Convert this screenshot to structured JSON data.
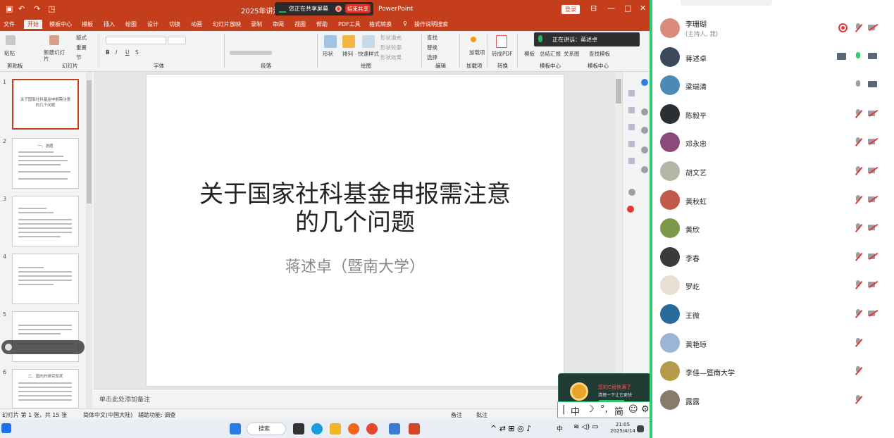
{
  "ppt": {
    "title_doc": "2025年讲演",
    "share_text": "您正在共享屏幕",
    "stop_share": "结束共享",
    "app_name": "PowerPoint",
    "login": "登录",
    "menu": [
      "文件",
      "开始",
      "模板中心",
      "模板",
      "插入",
      "绘图",
      "设计",
      "切换",
      "动画",
      "幻灯片放映",
      "录制",
      "审阅",
      "视图",
      "帮助",
      "PDF工具",
      "格式转换",
      "操作说明搜索"
    ],
    "active_menu": "开始",
    "ribbon_groups": [
      "剪贴板",
      "幻灯片",
      "字体",
      "段落",
      "绘图",
      "编辑",
      "加载项",
      "转换",
      "模板中心",
      "模板中心"
    ],
    "ribbon_labels": {
      "paste": "粘贴",
      "new_slide": "新建幻灯片",
      "layout": "版式",
      "reset": "重置",
      "section": "节",
      "shape": "形状",
      "arrange": "排列",
      "quick_style": "快速样式",
      "shape_fill": "形状填充",
      "shape_outline": "形状轮廓",
      "shape_effect": "形状效果",
      "find": "查找",
      "replace": "替换",
      "select": "选择",
      "addins": "加载项",
      "to_pdf": "转成PDF",
      "template": "模板",
      "summary": "总结汇报",
      "relation": "关系图",
      "find_template": "查找模板"
    },
    "speaking": "正在讲话：蒋述卓",
    "slide": {
      "title_line1": "关于国家社科基金申报需注意",
      "title_line2": "的几个问题",
      "subtitle": "蒋述卓（暨南大学）"
    },
    "thumb_numbers": [
      "1",
      "2",
      "3",
      "4",
      "5",
      "6"
    ],
    "thumb1_title": "关于国家社科基金申报需注意的几个问题",
    "thumb2_title": "一、选题",
    "thumb6_title": "二、国内外研究现状",
    "notes_placeholder": "单击此处添加备注",
    "status": {
      "slide_pos": "幻灯片 第 1 张，共 15 张",
      "lang": "简体中文(中国大陆)",
      "accessibility": "辅助功能: 调查",
      "notes": "备注",
      "comments": "批注"
    },
    "side_labels": [
      "打开",
      "设计",
      "帮助",
      "讲课"
    ]
  },
  "taskbar": {
    "search": "搜索",
    "time": "21:05",
    "date": "2025/4/14",
    "ime_label": "中"
  },
  "popup": {
    "line1": "您的C盘快满了",
    "line2": "清理一下让它更快"
  },
  "ime": {
    "chars": [
      "中",
      "简"
    ]
  },
  "participants": [
    {
      "name": "李珊瑚",
      "sub": "(主持人, 我)",
      "mic": "off",
      "cam": "off",
      "rec": true,
      "avatar_color": "#d98a7a"
    },
    {
      "name": "蒋述卓",
      "sub": "",
      "mic": "on",
      "cam": "on",
      "screen": true,
      "avatar_color": "#3a4a5a"
    },
    {
      "name": "梁瑞清",
      "sub": "",
      "mic": "plain",
      "cam": "on",
      "avatar_color": "#4a8ab5"
    },
    {
      "name": "陈毅平",
      "sub": "",
      "mic": "off",
      "cam": "off",
      "avatar_color": "#2b2f33"
    },
    {
      "name": "邓永忠",
      "sub": "",
      "mic": "off",
      "cam": "off",
      "avatar_color": "#8a4a7a"
    },
    {
      "name": "胡文艺",
      "sub": "",
      "mic": "off",
      "cam": "off",
      "avatar_color": "#b5b5a5"
    },
    {
      "name": "黄秋虹",
      "sub": "",
      "mic": "off",
      "cam": "off",
      "avatar_color": "#c05a4a"
    },
    {
      "name": "黄欣",
      "sub": "",
      "mic": "off",
      "cam": "off",
      "avatar_color": "#7a9a4a"
    },
    {
      "name": "李春",
      "sub": "",
      "mic": "off",
      "cam": "off",
      "avatar_color": "#3a3a3a"
    },
    {
      "name": "罗屹",
      "sub": "",
      "mic": "off",
      "cam": "off",
      "avatar_color": "#e8e0d0"
    },
    {
      "name": "王微",
      "sub": "",
      "mic": "off",
      "cam": "off",
      "avatar_color": "#2a6a9a"
    },
    {
      "name": "黄艳琼",
      "sub": "",
      "mic": "off",
      "cam": "none",
      "avatar_color": "#9ab5d5"
    },
    {
      "name": "李佳—暨南大学",
      "sub": "",
      "mic": "off",
      "cam": "none",
      "avatar_color": "#b59a4a"
    },
    {
      "name": "露露",
      "sub": "",
      "mic": "off",
      "cam": "none",
      "avatar_color": "#8a7a6a"
    }
  ]
}
